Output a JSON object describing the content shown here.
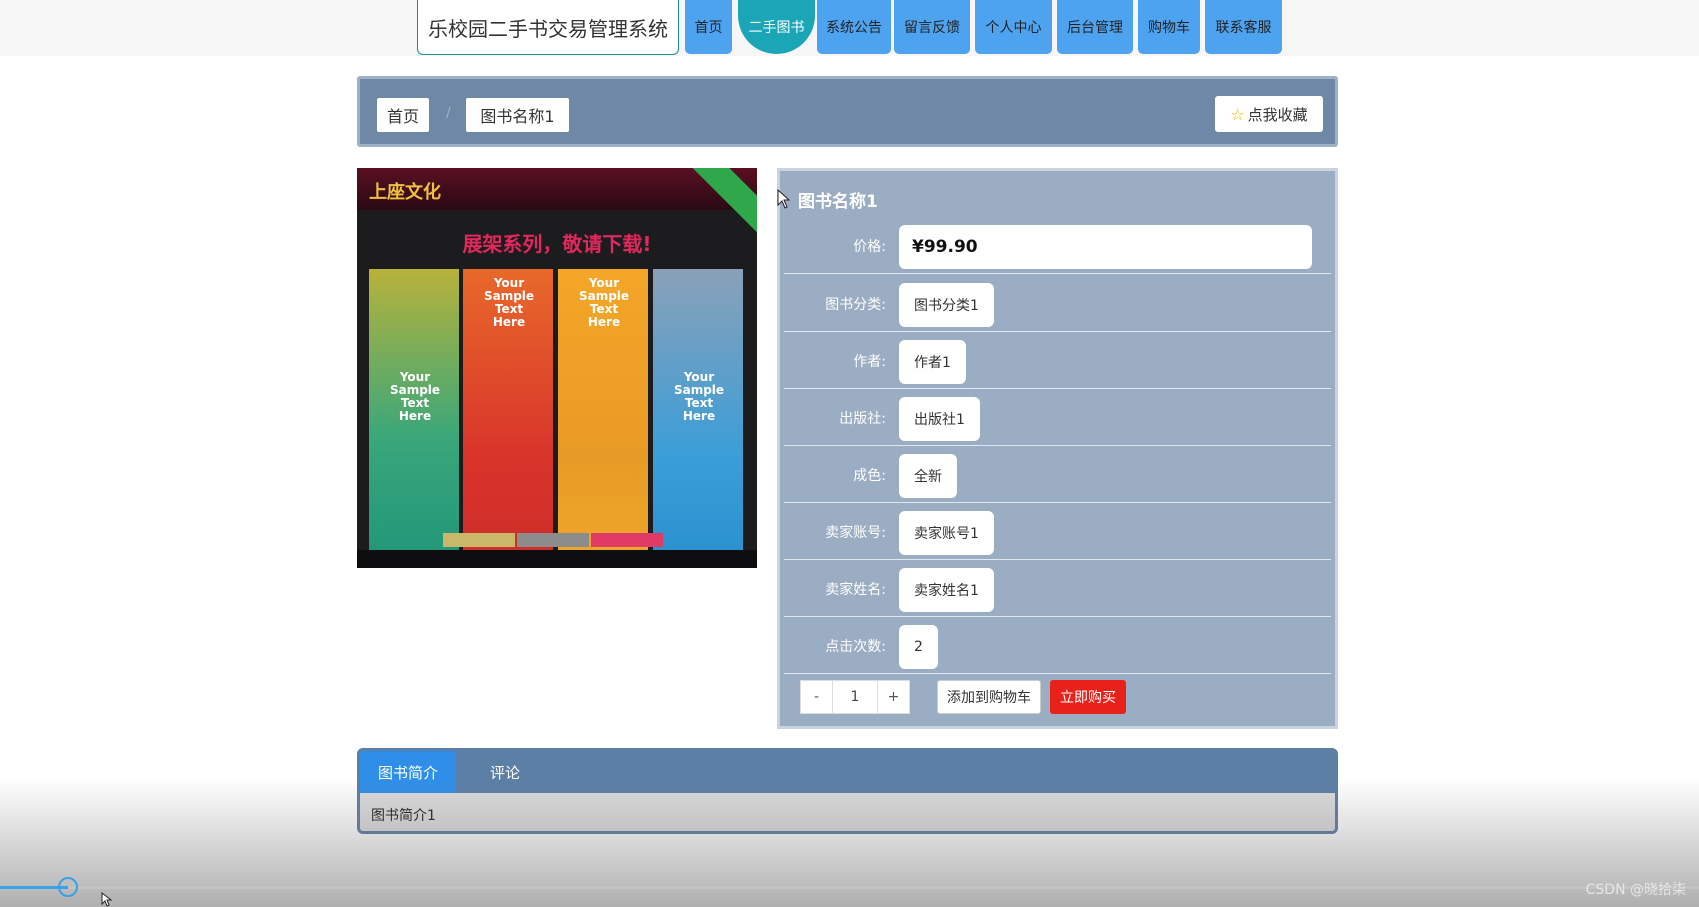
{
  "nav": {
    "brand": "乐校园二手书交易管理系统",
    "items": [
      "首页",
      "二手图书",
      "系统公告",
      "留言反馈",
      "个人中心",
      "后台管理",
      "购物车",
      "联系客服"
    ],
    "active_index": 1
  },
  "breadcrumb": {
    "home": "首页",
    "separator": "/",
    "current": "图书名称1",
    "favorite_label": "点我收藏"
  },
  "poster": {
    "logo_text": "上座文化",
    "headline": "展架系列，敬请下载!",
    "panel_texts": [
      "Your Sample Text Here",
      "Your Sample Text Here",
      "Your Sample Text Here",
      "Your Sample Text Here"
    ]
  },
  "details": {
    "title": "图书名称1",
    "rows": [
      {
        "label": "价格:",
        "value": "¥99.90"
      },
      {
        "label": "图书分类:",
        "value": "图书分类1"
      },
      {
        "label": "作者:",
        "value": "作者1"
      },
      {
        "label": "出版社:",
        "value": "出版社1"
      },
      {
        "label": "成色:",
        "value": "全新"
      },
      {
        "label": "卖家账号:",
        "value": "卖家账号1"
      },
      {
        "label": "卖家姓名:",
        "value": "卖家姓名1"
      },
      {
        "label": "点击次数:",
        "value": "2"
      }
    ],
    "quantity": {
      "minus": "-",
      "value": "1",
      "plus": "+"
    },
    "add_to_cart": "添加到购物车",
    "buy_now": "立即购买"
  },
  "tabs": {
    "items": [
      "图书简介",
      "评论"
    ],
    "active_index": 0,
    "content": "图书简介1"
  },
  "video_player": {
    "progress_fraction": 0.04
  },
  "watermark": "CSDN @晓拾柒",
  "colors": {
    "nav_button": "#4ea3f0",
    "nav_active": "#1ba6b8",
    "breadcrumb_bar": "#6e88a5",
    "details_panel": "#9badc2",
    "buy_button": "#e8221a",
    "tab_active": "#2f8fe8"
  }
}
